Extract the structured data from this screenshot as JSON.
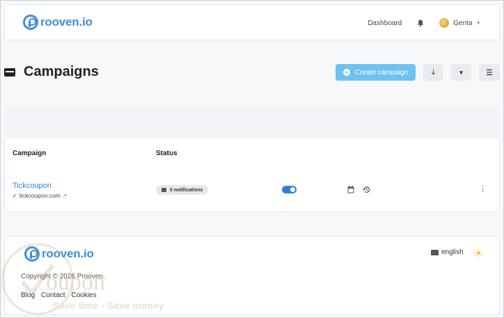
{
  "brand": {
    "name": "rooven.io",
    "color": "#3d8fdc"
  },
  "nav": {
    "dashboard": "Dashboard",
    "bell_icon": "bell-icon",
    "user": "Genta",
    "caret": "▾"
  },
  "page": {
    "title": "Campaigns",
    "create_label": "Create campaign",
    "create_icon": "+"
  },
  "toolbar": {
    "download_icon": "⤓",
    "filter_icon": "▼",
    "list_icon": "☰"
  },
  "table": {
    "headers": {
      "campaign": "Campaign",
      "status": "Status"
    },
    "rows": [
      {
        "name": "Tickcoupon",
        "check": "✔",
        "url": "tickcoupon.com",
        "ext": "↗",
        "notifications": "0 notifications",
        "menu": "⋮"
      }
    ]
  },
  "footer": {
    "brand": "rooven.io",
    "language": "english",
    "copyright": "Copyright © 2026 Prooven.",
    "links": [
      "Blog",
      "Contact",
      "Cookies"
    ]
  },
  "watermark": {
    "word": "oupon",
    "tagline": "Save time - Save money"
  }
}
